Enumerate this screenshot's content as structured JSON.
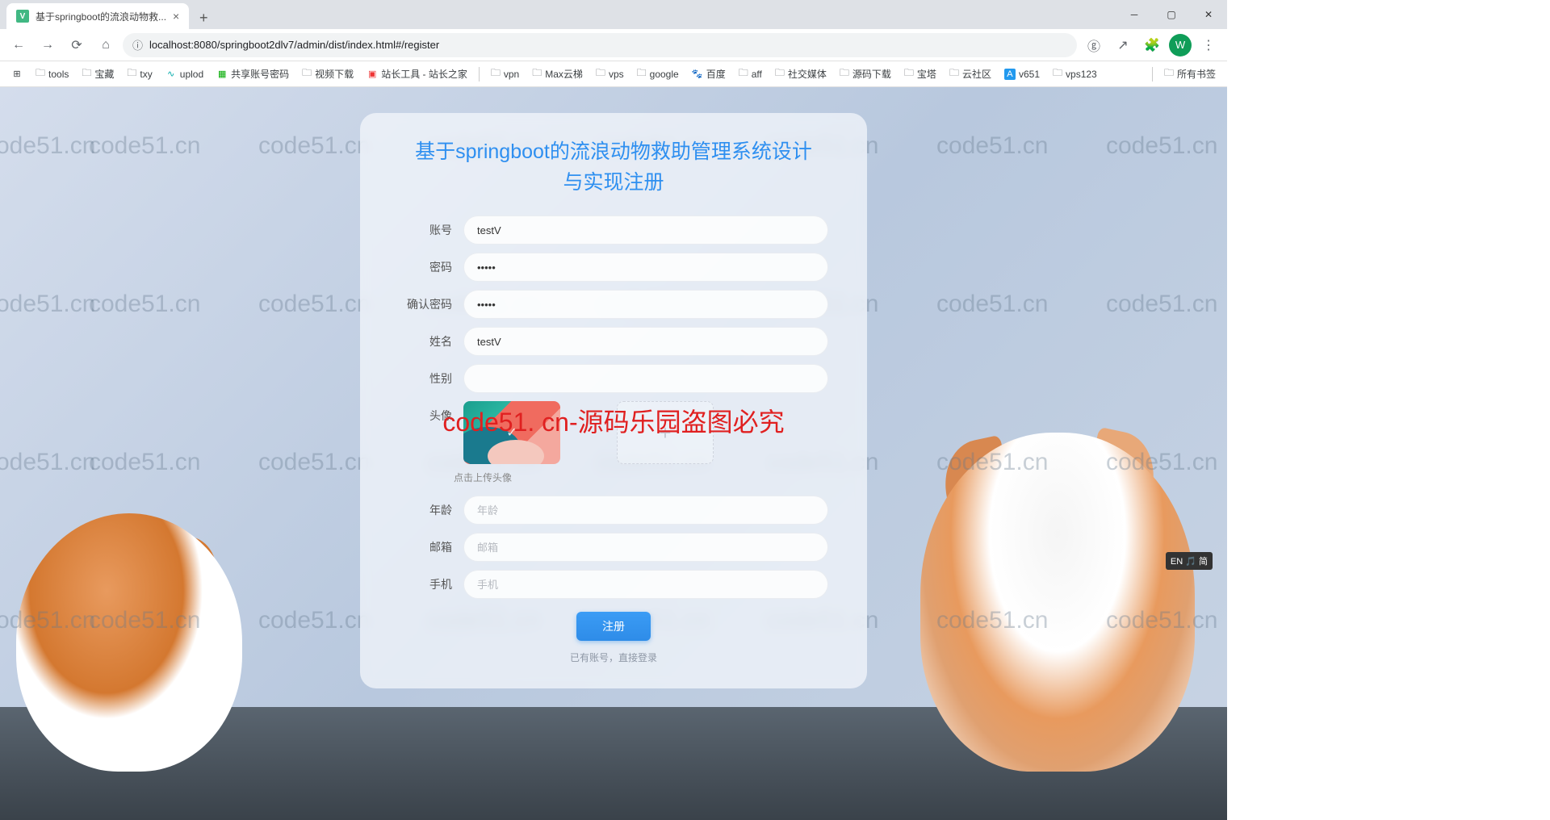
{
  "browser": {
    "tab_title": "基于springboot的流浪动物救...",
    "url": "localhost:8080/springboot2dlv7/admin/dist/index.html#/register",
    "profile_letter": "W",
    "bookmarks": [
      "tools",
      "宝藏",
      "txy",
      "uplod",
      "共享账号密码",
      "视频下载",
      "站长工具 - 站长之家",
      "vpn",
      "Max云梯",
      "vps",
      "google",
      "百度",
      "aff",
      "社交媒体",
      "源码下载",
      "宝塔",
      "云社区",
      "v651",
      "vps123"
    ],
    "all_bookmarks": "所有书签"
  },
  "watermark": {
    "text": "code51.cn",
    "main": "code51. cn-源码乐园盗图必究"
  },
  "card": {
    "title": "基于springboot的流浪动物救助管理系统设计与实现注册",
    "fields": {
      "account_label": "账号",
      "account_value": "testV",
      "password_label": "密码",
      "confirm_label": "确认密码",
      "name_label": "姓名",
      "name_value": "testV",
      "gender_label": "性别",
      "avatar_label": "头像",
      "avatar_hint": "点击上传头像",
      "age_label": "年龄",
      "age_placeholder": "年龄",
      "email_label": "邮箱",
      "email_placeholder": "邮箱",
      "phone_label": "手机",
      "phone_placeholder": "手机"
    },
    "submit": "注册",
    "login_link": "已有账号，直接登录"
  },
  "ime": "EN 🎵 简"
}
